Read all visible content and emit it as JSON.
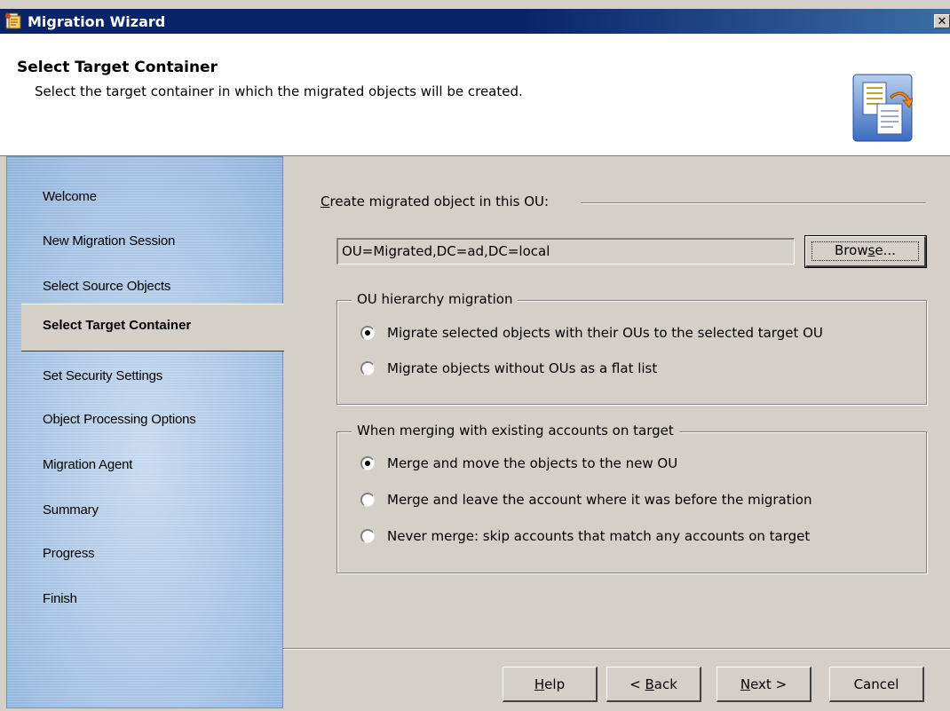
{
  "window": {
    "title": "Migration Wizard",
    "close_icon": "close-icon",
    "app_icon": "migration-wizard-icon"
  },
  "header": {
    "title": "Select Target Container",
    "subtitle": "Select the target container in which the migrated objects will be created.",
    "icon": "documents-arrow-icon"
  },
  "nav": {
    "items": [
      {
        "label": "Welcome"
      },
      {
        "label": "New Migration Session"
      },
      {
        "label": "Select Source Objects"
      },
      {
        "label": "Select Target Container",
        "active": true
      },
      {
        "label": "Set Security Settings"
      },
      {
        "label": "Object Processing Options"
      },
      {
        "label": "Migration Agent"
      },
      {
        "label": "Summary"
      },
      {
        "label": "Progress"
      },
      {
        "label": "Finish"
      }
    ]
  },
  "main": {
    "ou_label_prefix": "C",
    "ou_label_rest": "reate migrated object in this OU:",
    "ou_value": "OU=Migrated,DC=ad,DC=local",
    "browse_pre": "Brow",
    "browse_u": "s",
    "browse_post": "e...",
    "ou_hierarchy": {
      "legend": "OU hierarchy migration",
      "options": [
        {
          "label": "Migrate selected objects with their OUs to the selected target OU",
          "checked": true
        },
        {
          "label": "Migrate objects without OUs as a flat list",
          "checked": false
        }
      ]
    },
    "merging": {
      "legend": "When merging with existing accounts on target",
      "options": [
        {
          "label": "Merge and move the objects to the new OU",
          "checked": true
        },
        {
          "label": "Merge and leave the account where it was before the migration",
          "checked": false
        },
        {
          "label": "Never merge: skip accounts that match any accounts on target",
          "checked": false
        }
      ]
    }
  },
  "footer": {
    "help_u": "H",
    "help_rest": "elp",
    "back_pre": "< ",
    "back_u": "B",
    "back_rest": "ack",
    "next_u": "N",
    "next_rest": "ext >",
    "cancel": "Cancel"
  }
}
